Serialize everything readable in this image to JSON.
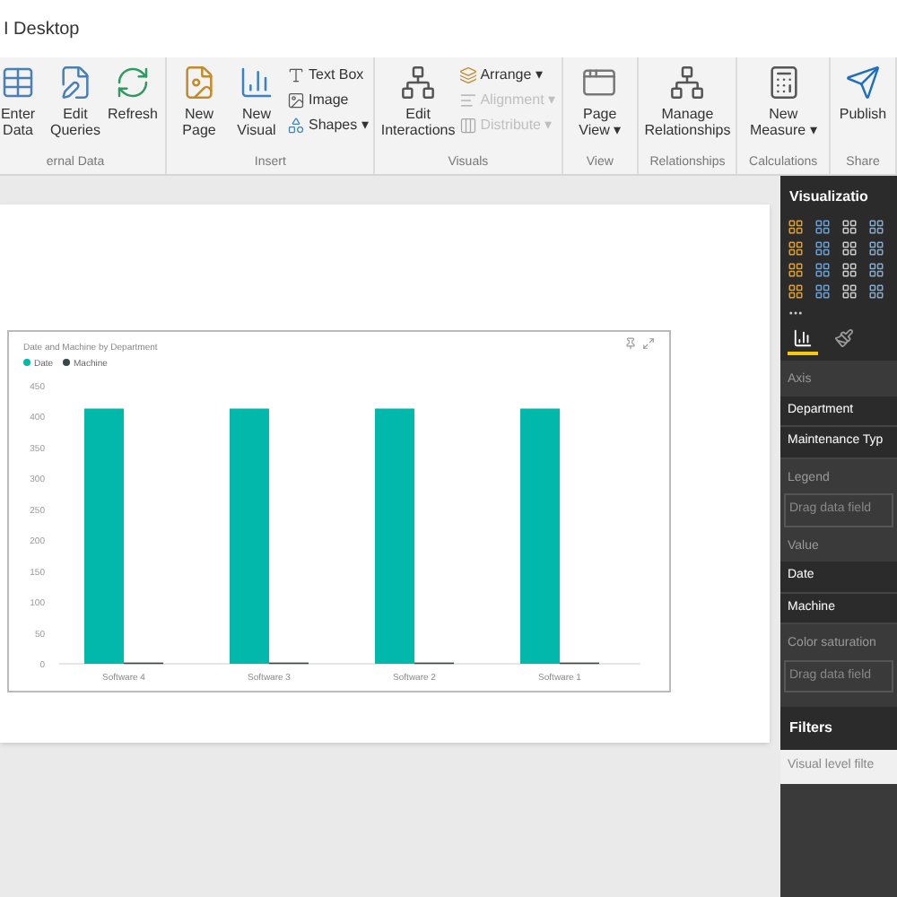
{
  "window": {
    "title": "I Desktop"
  },
  "ribbon": {
    "groups": [
      {
        "label": "ernal Data",
        "large": [
          {
            "label": "Enter Data"
          },
          {
            "label": "Edit Queries"
          },
          {
            "label": "Refresh"
          }
        ]
      },
      {
        "label": "Insert",
        "large": [
          {
            "label": "New Page"
          },
          {
            "label": "New Visual"
          }
        ],
        "small": [
          {
            "label": "Text Box",
            "disabled": false
          },
          {
            "label": "Image",
            "disabled": false
          },
          {
            "label": "Shapes ▾",
            "disabled": false
          }
        ]
      },
      {
        "label": "Visuals",
        "large": [
          {
            "label": "Edit Interactions"
          }
        ],
        "small": [
          {
            "label": "Arrange ▾",
            "disabled": false
          },
          {
            "label": "Alignment ▾",
            "disabled": true
          },
          {
            "label": "Distribute ▾",
            "disabled": true
          }
        ]
      },
      {
        "label": "View",
        "large": [
          {
            "label": "Page View ▾"
          }
        ]
      },
      {
        "label": "Relationships",
        "large": [
          {
            "label": "Manage Relationships"
          }
        ]
      },
      {
        "label": "Calculations",
        "large": [
          {
            "label": "New Measure ▾"
          }
        ]
      },
      {
        "label": "Share",
        "large": [
          {
            "label": "Publish"
          }
        ]
      }
    ]
  },
  "visual": {
    "chart_data": {
      "type": "bar",
      "title": "Date and Machine by Department",
      "legend": "top-left",
      "categories": [
        "Software 4",
        "Software 3",
        "Software 2",
        "Software 1"
      ],
      "series": [
        {
          "name": "Date",
          "color": "#01b8aa",
          "values": [
            413,
            413,
            413,
            413
          ]
        },
        {
          "name": "Machine",
          "color": "#374649",
          "values": [
            2,
            2,
            2,
            2
          ]
        }
      ],
      "ylim": [
        0,
        450
      ],
      "yticks": [
        0,
        50,
        100,
        150,
        200,
        250,
        300,
        350,
        400,
        450
      ]
    }
  },
  "panel": {
    "title": "Visualizatio",
    "tabs": [
      {
        "kind": "fields",
        "selected": true
      },
      {
        "kind": "format",
        "selected": false
      }
    ],
    "wells": [
      {
        "label": "Axis",
        "fields": [
          "Department",
          "Maintenance Typ"
        ]
      },
      {
        "label": "Legend",
        "placeholder": "Drag data field"
      },
      {
        "label": "Value",
        "fields": [
          "Date",
          "Machine"
        ]
      },
      {
        "label": "Color saturation",
        "placeholder": "Drag data field"
      }
    ]
  },
  "filters": {
    "title": "Filters",
    "section": "Visual level filte"
  }
}
